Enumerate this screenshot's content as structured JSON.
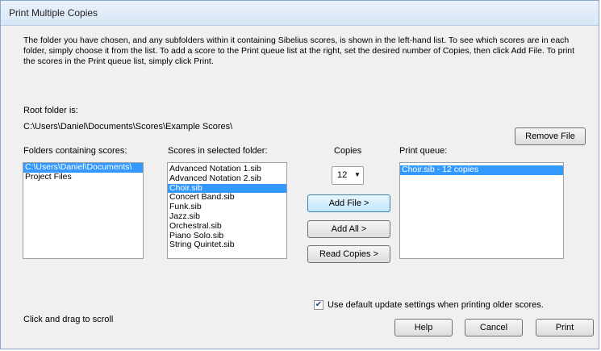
{
  "window": {
    "title": "Print Multiple Copies"
  },
  "intro": {
    "text": "The folder you have chosen, and any subfolders within it containing Sibelius scores, is shown in the left-hand list.  To see which scores are in each folder, simply choose it from the list.  To add a score to the Print queue list at the right, set the desired number of Copies, then click Add File.  To print the scores in the Print queue list, simply click Print."
  },
  "root": {
    "label": "Root folder is:",
    "path": "C:\\Users\\Daniel\\Documents\\Scores\\Example Scores\\"
  },
  "folders": {
    "label": "Folders containing scores:",
    "items": [
      "C:\\Users\\Daniel\\Documents\\",
      "Project Files"
    ]
  },
  "scores": {
    "label": "Scores in selected folder:",
    "items": [
      "Advanced Notation 1.sib",
      "Advanced Notation 2.sib",
      "Choir.sib",
      "Concert Band.sib",
      "Funk.sib",
      "Jazz.sib",
      "Orchestral.sib",
      "Piano Solo.sib",
      "String Quintet.sib"
    ]
  },
  "copies": {
    "label": "Copies",
    "value": "12"
  },
  "queue": {
    "label": "Print queue:",
    "items": [
      "Choir.sib - 12 copies"
    ]
  },
  "buttons": {
    "remove_file": "Remove File",
    "add_file": "Add File >",
    "add_all": "Add All >",
    "read_copies": "Read Copies >",
    "help": "Help",
    "cancel": "Cancel",
    "print": "Print"
  },
  "checkbox": {
    "label": "Use default update settings when printing older scores.",
    "checked": true
  },
  "hint": "Click and drag to scroll"
}
